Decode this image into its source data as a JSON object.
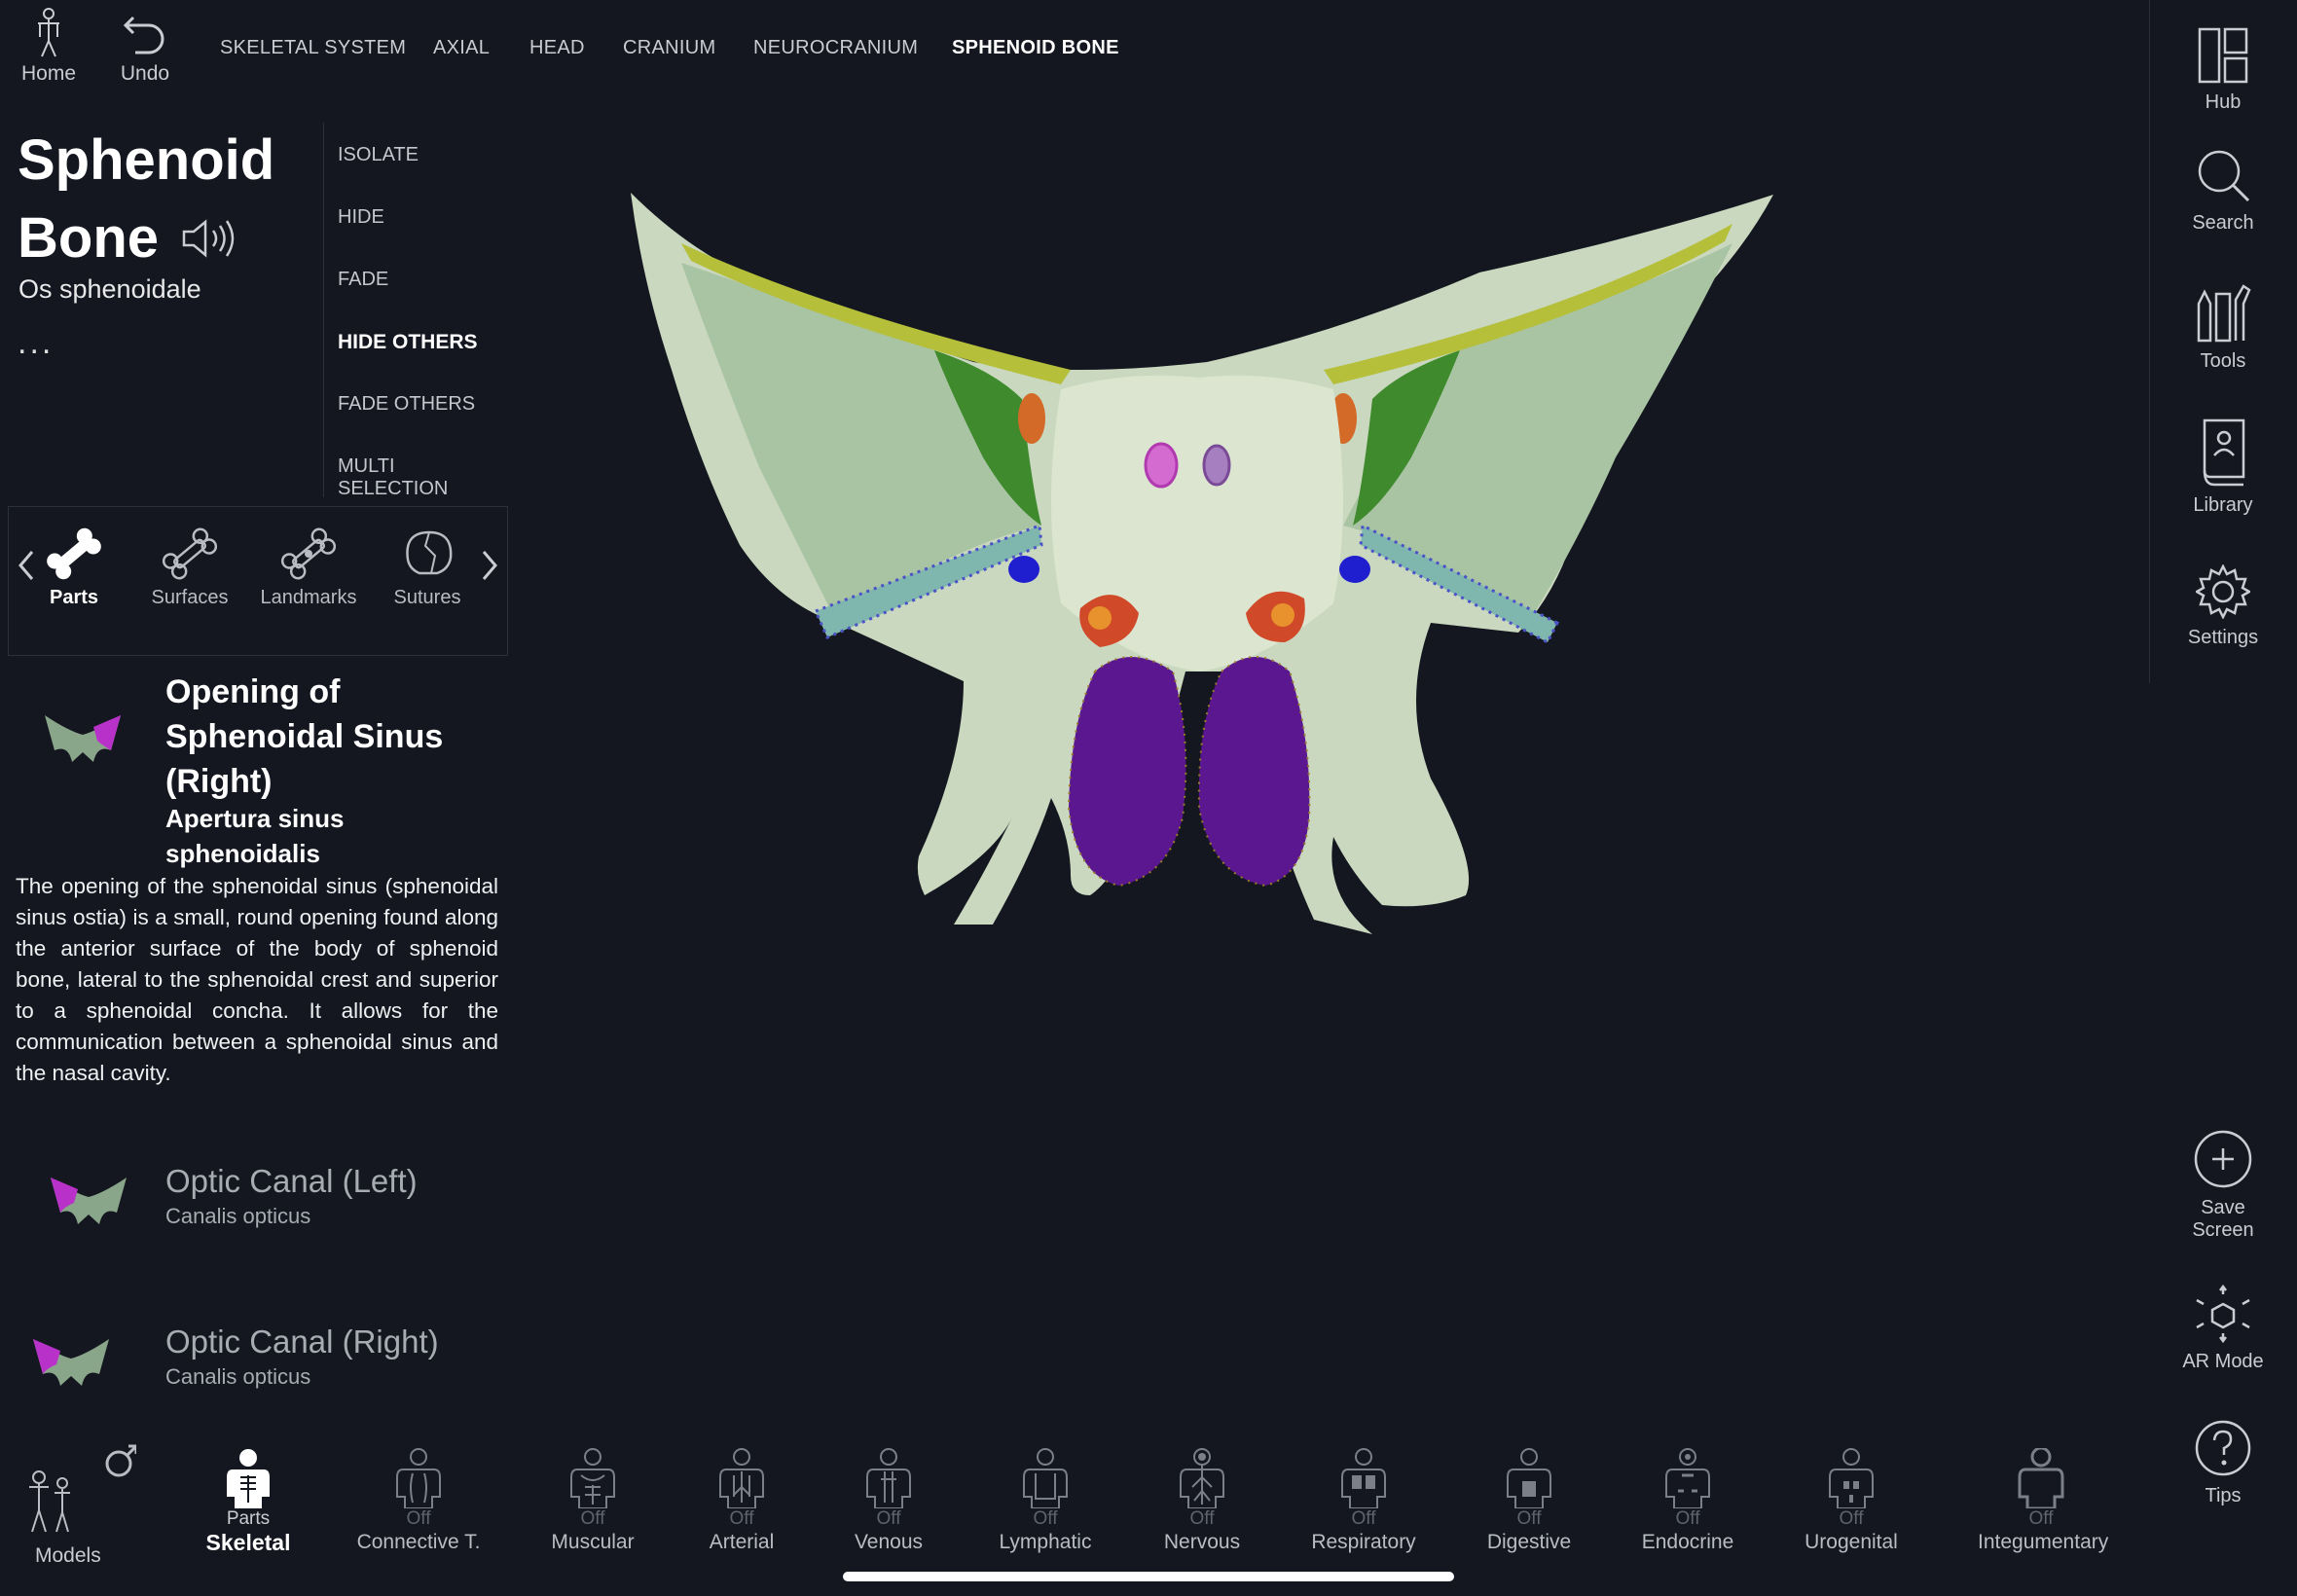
{
  "topbar": {
    "home_label": "Home",
    "undo_label": "Undo",
    "breadcrumbs": [
      "SKELETAL SYSTEM",
      "AXIAL",
      "HEAD",
      "CRANIUM",
      "NEUROCRANIUM",
      "SPHENOID BONE"
    ]
  },
  "structure": {
    "name_line1": "Sphenoid",
    "name_line2": "Bone",
    "latin": "Os sphenoidale",
    "more": "..."
  },
  "actions": [
    "ISOLATE",
    "HIDE",
    "FADE",
    "HIDE OTHERS",
    "FADE OTHERS",
    "MULTI SELECTION"
  ],
  "tabs": [
    "Parts",
    "Surfaces",
    "Landmarks",
    "Sutures"
  ],
  "selected_part": {
    "title": "Opening of Sphenoidal Sinus (Right)",
    "latin": "Apertura sinus sphenoidalis",
    "description": "The opening of the sphenoidal sinus (sphenoidal sinus ostia) is a small, round opening found along the anterior surface of the body of sphenoid bone, lateral to the sphenoidal crest and superior to a sphenoidal concha. It allows for the communication between a sphenoidal sinus and the nasal cavity."
  },
  "parts_list": [
    {
      "name": "Optic Canal (Left)",
      "latin": "Canalis opticus"
    },
    {
      "name": "Optic Canal (Right)",
      "latin": "Canalis opticus"
    }
  ],
  "right_bar": {
    "hub": "Hub",
    "search": "Search",
    "tools": "Tools",
    "library": "Library",
    "settings": "Settings",
    "save_line1": "Save",
    "save_line2": "Screen",
    "ar": "AR Mode",
    "tips": "Tips"
  },
  "bottom": {
    "models_label": "Models",
    "systems": [
      {
        "state": "Parts",
        "name": "Skeletal"
      },
      {
        "state": "Off",
        "name": "Connective T."
      },
      {
        "state": "Off",
        "name": "Muscular"
      },
      {
        "state": "Off",
        "name": "Arterial"
      },
      {
        "state": "Off",
        "name": "Venous"
      },
      {
        "state": "Off",
        "name": "Lymphatic"
      },
      {
        "state": "Off",
        "name": "Nervous"
      },
      {
        "state": "Off",
        "name": "Respiratory"
      },
      {
        "state": "Off",
        "name": "Digestive"
      },
      {
        "state": "Off",
        "name": "Endocrine"
      },
      {
        "state": "Off",
        "name": "Urogenital"
      },
      {
        "state": "Off",
        "name": "Integumentary"
      }
    ]
  },
  "colors": {
    "background": "#14171f",
    "bone": "#cfdcc2",
    "sinus_highlight": "#5b1790",
    "groove": "#2f8a1e",
    "fissure": "#5fa0a0"
  }
}
